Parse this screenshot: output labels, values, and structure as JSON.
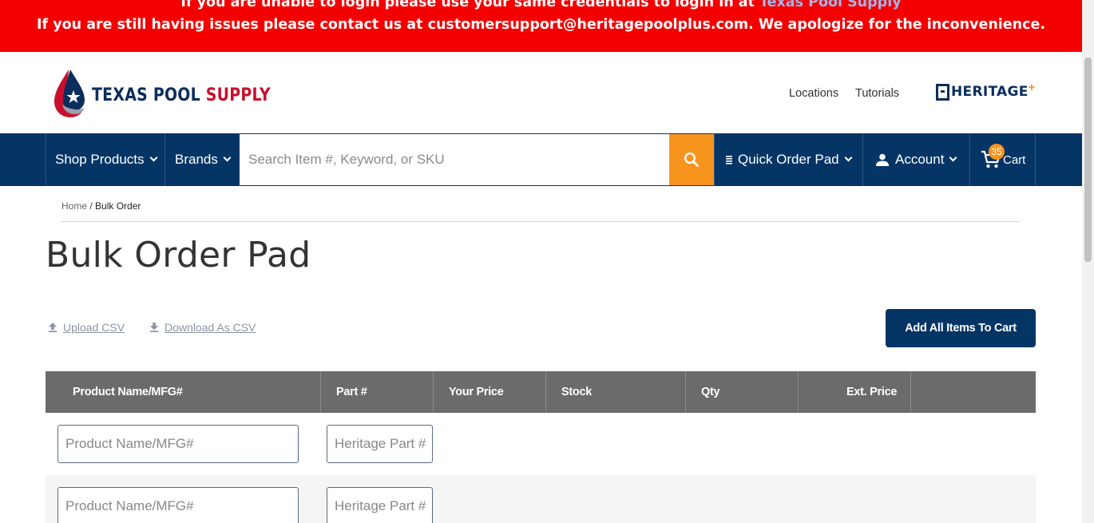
{
  "alert": {
    "line1_prefix": "If you are unable to login please use your same credentials to login in at ",
    "line1_link": "Texas Pool Supply",
    "line2": "If you are still having issues please contact us at customersupport@heritagepoolplus.com. We apologize for the inconvenience.",
    "bg_color": "#f50000"
  },
  "header": {
    "logo_word1": "TEXAS POOL ",
    "logo_word2": "SUPPLY",
    "links": [
      "Locations",
      "Tutorials"
    ],
    "partner_logo": "HERITAGE",
    "partner_plus": "+"
  },
  "nav": {
    "shop_products": "Shop Products",
    "brands": "Brands",
    "search_placeholder": "Search Item #, Keyword, or SKU",
    "quick_order": "Quick Order Pad",
    "account": "Account",
    "cart": "Cart",
    "cart_count": "35",
    "bg_color": "#053565",
    "accent_color": "#f7941d"
  },
  "breadcrumb": {
    "home": "Home",
    "separator": " / ",
    "current": "Bulk Order"
  },
  "page": {
    "title": "Bulk Order Pad",
    "upload_csv": "Upload CSV",
    "download_csv": "Download As CSV",
    "add_all": "Add All Items To Cart"
  },
  "table": {
    "headers": [
      "Product Name/MFG#",
      "Part #",
      "Your Price",
      "Stock",
      "Qty",
      "Ext. Price"
    ],
    "rows": [
      {
        "product_placeholder": "Product Name/MFG#",
        "part_placeholder": "Heritage Part #"
      },
      {
        "product_placeholder": "Product Name/MFG#",
        "part_placeholder": "Heritage Part #"
      }
    ]
  }
}
